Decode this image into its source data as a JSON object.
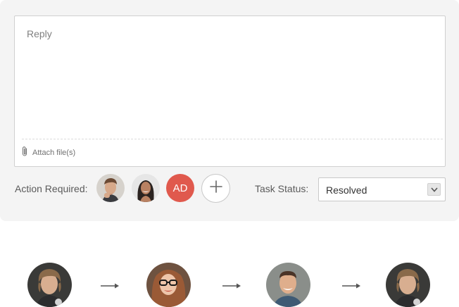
{
  "reply": {
    "placeholder": "Reply",
    "attach_label": "Attach file(s)"
  },
  "action_required": {
    "label": "Action Required:",
    "assignees": [
      {
        "type": "photo",
        "icon": "male-avatar"
      },
      {
        "type": "photo",
        "icon": "female-avatar"
      },
      {
        "type": "initials",
        "initials": "AD",
        "color": "#e0594d"
      }
    ],
    "add_icon": "plus-icon"
  },
  "task_status": {
    "label": "Task Status:",
    "value": "Resolved",
    "caret_icon": "chevron-down-icon"
  },
  "workflow": {
    "steps": [
      {
        "icon": "male-avatar"
      },
      {
        "icon": "female-glasses-avatar"
      },
      {
        "icon": "smiling-male-avatar"
      },
      {
        "icon": "male-avatar"
      }
    ],
    "connector_icon": "arrow-right-icon"
  },
  "colors": {
    "panel_bg": "#f4f4f4",
    "accent_red": "#e0594d"
  }
}
